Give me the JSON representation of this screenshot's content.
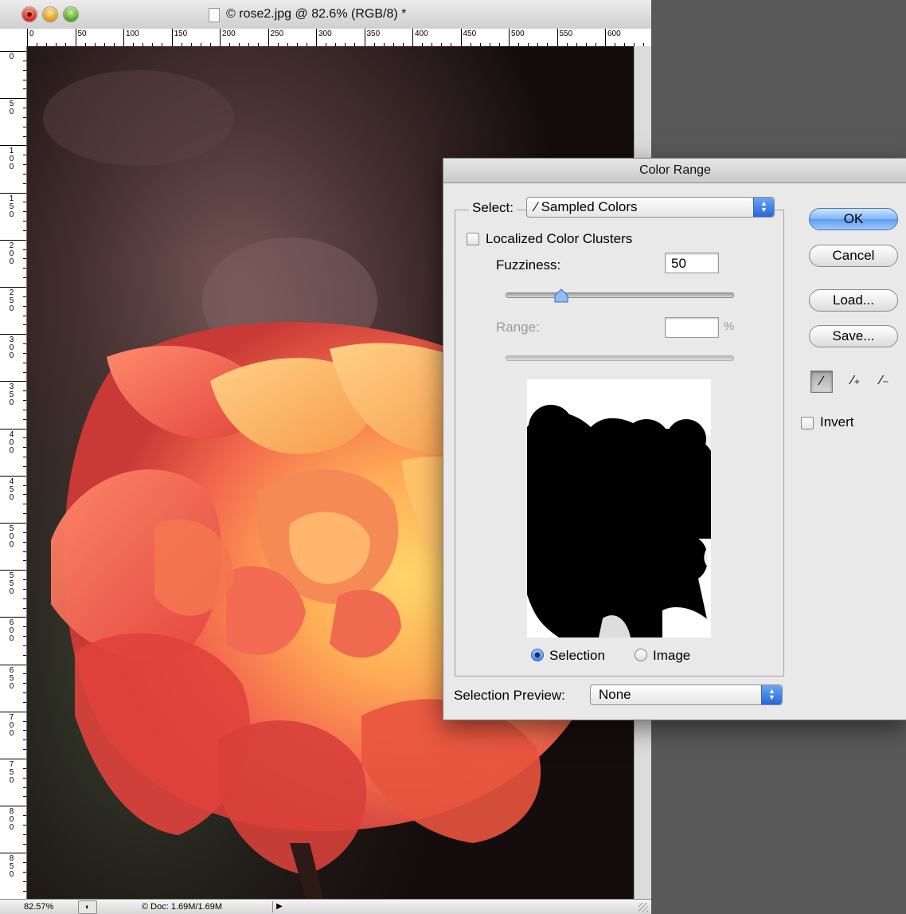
{
  "document": {
    "title": "© rose2.jpg @ 82.6% (RGB/8) *",
    "ruler_top_labels": [
      "0",
      "50",
      "100",
      "150",
      "200",
      "250",
      "300",
      "350",
      "400",
      "450",
      "500",
      "550",
      "600"
    ],
    "ruler_left_labels": [
      "0",
      "5\n0",
      "1\n0\n0",
      "1\n5\n0",
      "2\n0\n0",
      "2\n5\n0",
      "3\n0\n0",
      "3\n5\n0",
      "4\n0\n0",
      "4\n5\n0",
      "5\n0\n0",
      "5\n5\n0",
      "6\n0\n0",
      "6\n5\n0",
      "7\n0\n0",
      "7\n5\n0",
      "8\n0\n0",
      "8\n5\n0",
      "9"
    ]
  },
  "statusbar": {
    "zoom": "82.57%",
    "doc_size": "© Doc: 1.69M/1.69M"
  },
  "dialog": {
    "title": "Color Range",
    "select_label": "Select:",
    "select_value": "Sampled Colors",
    "localized_label": "Localized Color Clusters",
    "localized_checked": false,
    "fuzziness_label": "Fuzziness:",
    "fuzziness_value": "50",
    "fuzziness_level": 0.36,
    "range_label": "Range:",
    "range_value": "",
    "range_unit": "%",
    "radio_selection": "Selection",
    "radio_image": "Image",
    "selected_radio": "Selection",
    "selection_preview_label": "Selection Preview:",
    "selection_preview_value": "None",
    "buttons": {
      "ok": "OK",
      "cancel": "Cancel",
      "load": "Load...",
      "save": "Save..."
    },
    "invert_label": "Invert",
    "invert_checked": false,
    "accent_color": "#3d82e6"
  }
}
